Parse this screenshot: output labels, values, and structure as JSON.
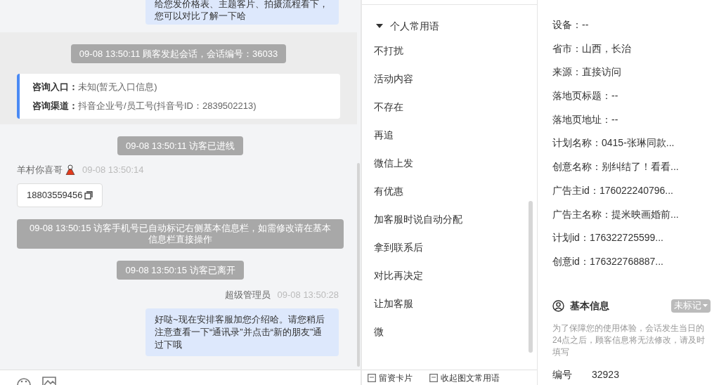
{
  "chat": {
    "messages": [
      {
        "kind": "agent_bubble",
        "text": "给您发价格表、主题客片、拍摄流程看下，您可以对比了解一下哈"
      },
      {
        "kind": "session_block",
        "notice": "09-08 13:50:11 顾客发起会话，会话编号：36033",
        "fields": [
          {
            "label": "咨询入口：",
            "value": "未知(暂无入口信息)"
          },
          {
            "label": "咨询渠道：",
            "value": "抖音企业号/员工号(抖音号ID：2839502213)"
          }
        ]
      },
      {
        "kind": "notice",
        "text": "09-08 13:50:11 访客已进线"
      },
      {
        "kind": "visitor",
        "name": "羊村你喜哥",
        "time": "09-08 13:50:14",
        "text": "18803559456"
      },
      {
        "kind": "notice",
        "text": "09-08 13:50:15 访客手机号已自动标记右侧基本信息栏，如需修改请在基本信息栏直接操作"
      },
      {
        "kind": "notice",
        "text": "09-08 13:50:15 访客已离开"
      },
      {
        "kind": "agent",
        "name": "超级管理员",
        "time": "09-08 13:50:28",
        "text": "好哒~现在安排客服加您介绍哈。请您稍后注意查看一下“通讯录”并点击“新的朋友”通过下哦"
      }
    ]
  },
  "phrases": {
    "group": {
      "label": "个人常用语",
      "expanded": true
    },
    "items": [
      "不打扰",
      "活动内容",
      "不存在",
      "再追",
      "微信上发",
      "有优惠",
      "加客服时说自动分配",
      "拿到联系后",
      "对比再决定",
      "让加客服",
      "微"
    ],
    "footer": [
      "留资卡片",
      "收起图文常用语"
    ]
  },
  "source_info": {
    "rows": [
      "设备：--",
      "省市：山西，长治",
      "来源：直接访问",
      "落地页标题：--",
      "落地页地址：--",
      "计划名称：0415-张琳同款...",
      "创意名称：别纠结了！看看...",
      "广告主id：176022240796...",
      "广告主名称：提米映画婚前...",
      "计划id：176322725599...",
      "创意id：176322768887..."
    ]
  },
  "basic_info": {
    "title": "基本信息",
    "tag": "未标记",
    "note": "为了保障您的使用体验，会话发生当日的24点之后，顾客信息将无法修改，请及时填写",
    "fields": [
      {
        "label": "编号",
        "value": "32923"
      }
    ]
  }
}
